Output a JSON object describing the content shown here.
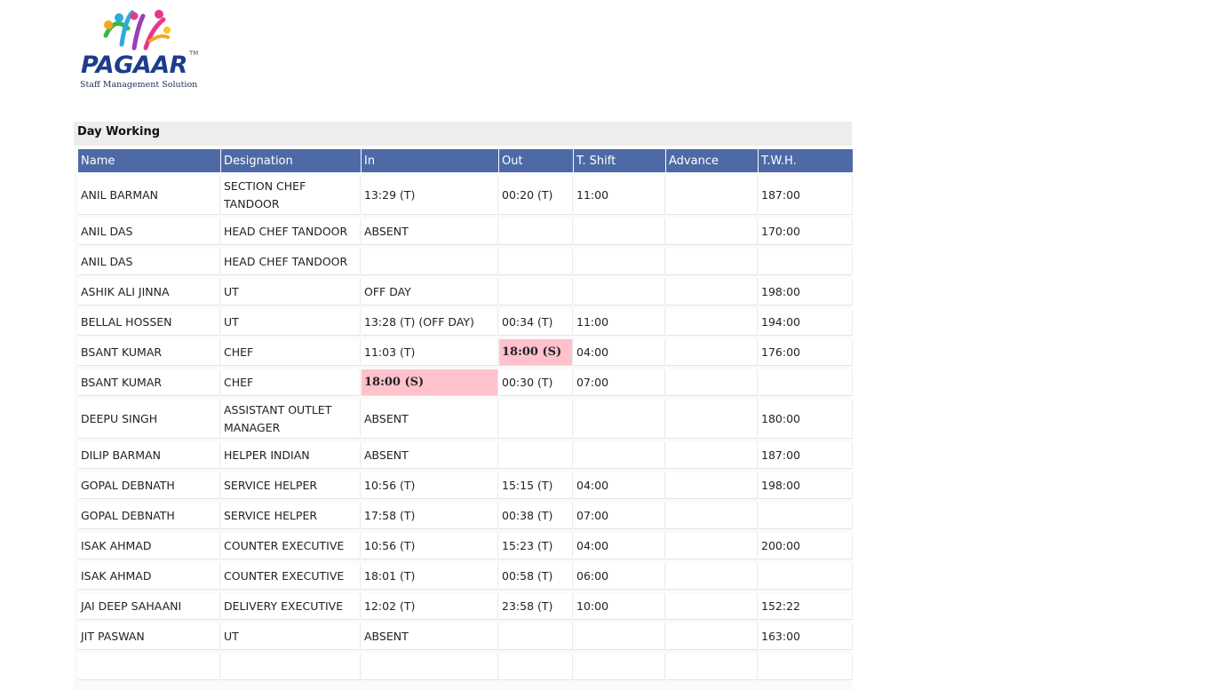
{
  "brand": {
    "logo_text": "PAGAAR",
    "tagline": "Staff Management Solution"
  },
  "panel": {
    "title": "Day Working"
  },
  "colors": {
    "header_bg": "#4e6aa6",
    "highlight_bg": "#ffc1cc",
    "logo_blue": "#1d3c8c"
  },
  "table": {
    "columns": [
      "Name",
      "Designation",
      "In",
      "Out",
      "T. Shift",
      "Advance",
      "T.W.H."
    ],
    "rows": [
      {
        "name": "ANIL BARMAN",
        "designation": "SECTION CHEF TANDOOR",
        "in": "13:29 (T)",
        "out": "00:20 (T)",
        "shift": "11:00",
        "advance": "",
        "twh": "187:00",
        "tall": true
      },
      {
        "name": "ANIL DAS",
        "designation": "HEAD CHEF TANDOOR",
        "in": "ABSENT",
        "out": "",
        "shift": "",
        "advance": "",
        "twh": "170:00"
      },
      {
        "name": "ANIL DAS",
        "designation": "HEAD CHEF TANDOOR",
        "in": "",
        "out": "",
        "shift": "",
        "advance": "",
        "twh": ""
      },
      {
        "name": "ASHIK ALI JINNA",
        "designation": "UT",
        "in": "OFF DAY",
        "out": "",
        "shift": "",
        "advance": "",
        "twh": "198:00"
      },
      {
        "name": "BELLAL HOSSEN",
        "designation": "UT",
        "in": "13:28 (T) (OFF DAY)",
        "out": "00:34 (T)",
        "shift": "11:00",
        "advance": "",
        "twh": "194:00"
      },
      {
        "name": "BSANT KUMAR",
        "designation": "CHEF",
        "in": "11:03 (T)",
        "out": "18:00 (S)",
        "shift": "04:00",
        "advance": "",
        "twh": "176:00",
        "hl_out": true
      },
      {
        "name": "BSANT KUMAR",
        "designation": "CHEF",
        "in": "18:00 (S)",
        "out": "00:30 (T)",
        "shift": "07:00",
        "advance": "",
        "twh": "",
        "hl_in": true
      },
      {
        "name": "DEEPU SINGH",
        "designation": "ASSISTANT OUTLET MANAGER",
        "in": "ABSENT",
        "out": "",
        "shift": "",
        "advance": "",
        "twh": "180:00",
        "tall": true
      },
      {
        "name": "DILIP BARMAN",
        "designation": "HELPER INDIAN",
        "in": "ABSENT",
        "out": "",
        "shift": "",
        "advance": "",
        "twh": "187:00"
      },
      {
        "name": "GOPAL DEBNATH",
        "designation": "SERVICE HELPER",
        "in": "10:56 (T)",
        "out": "15:15 (T)",
        "shift": "04:00",
        "advance": "",
        "twh": "198:00"
      },
      {
        "name": "GOPAL DEBNATH",
        "designation": "SERVICE HELPER",
        "in": "17:58 (T)",
        "out": "00:38 (T)",
        "shift": "07:00",
        "advance": "",
        "twh": ""
      },
      {
        "name": "ISAK AHMAD",
        "designation": "COUNTER EXECUTIVE",
        "in": "10:56 (T)",
        "out": "15:23 (T)",
        "shift": "04:00",
        "advance": "",
        "twh": "200:00"
      },
      {
        "name": "ISAK AHMAD",
        "designation": "COUNTER EXECUTIVE",
        "in": "18:01 (T)",
        "out": "00:58 (T)",
        "shift": "06:00",
        "advance": "",
        "twh": ""
      },
      {
        "name": "JAI DEEP SAHAANI",
        "designation": "DELIVERY EXECUTIVE",
        "in": "12:02 (T)",
        "out": "23:58 (T)",
        "shift": "10:00",
        "advance": "",
        "twh": "152:22"
      },
      {
        "name": "JIT PASWAN",
        "designation": "UT",
        "in": "ABSENT",
        "out": "",
        "shift": "",
        "advance": "",
        "twh": "163:00"
      },
      {
        "name": "",
        "designation": "",
        "in": "",
        "out": "",
        "shift": "",
        "advance": "",
        "twh": ""
      }
    ]
  }
}
